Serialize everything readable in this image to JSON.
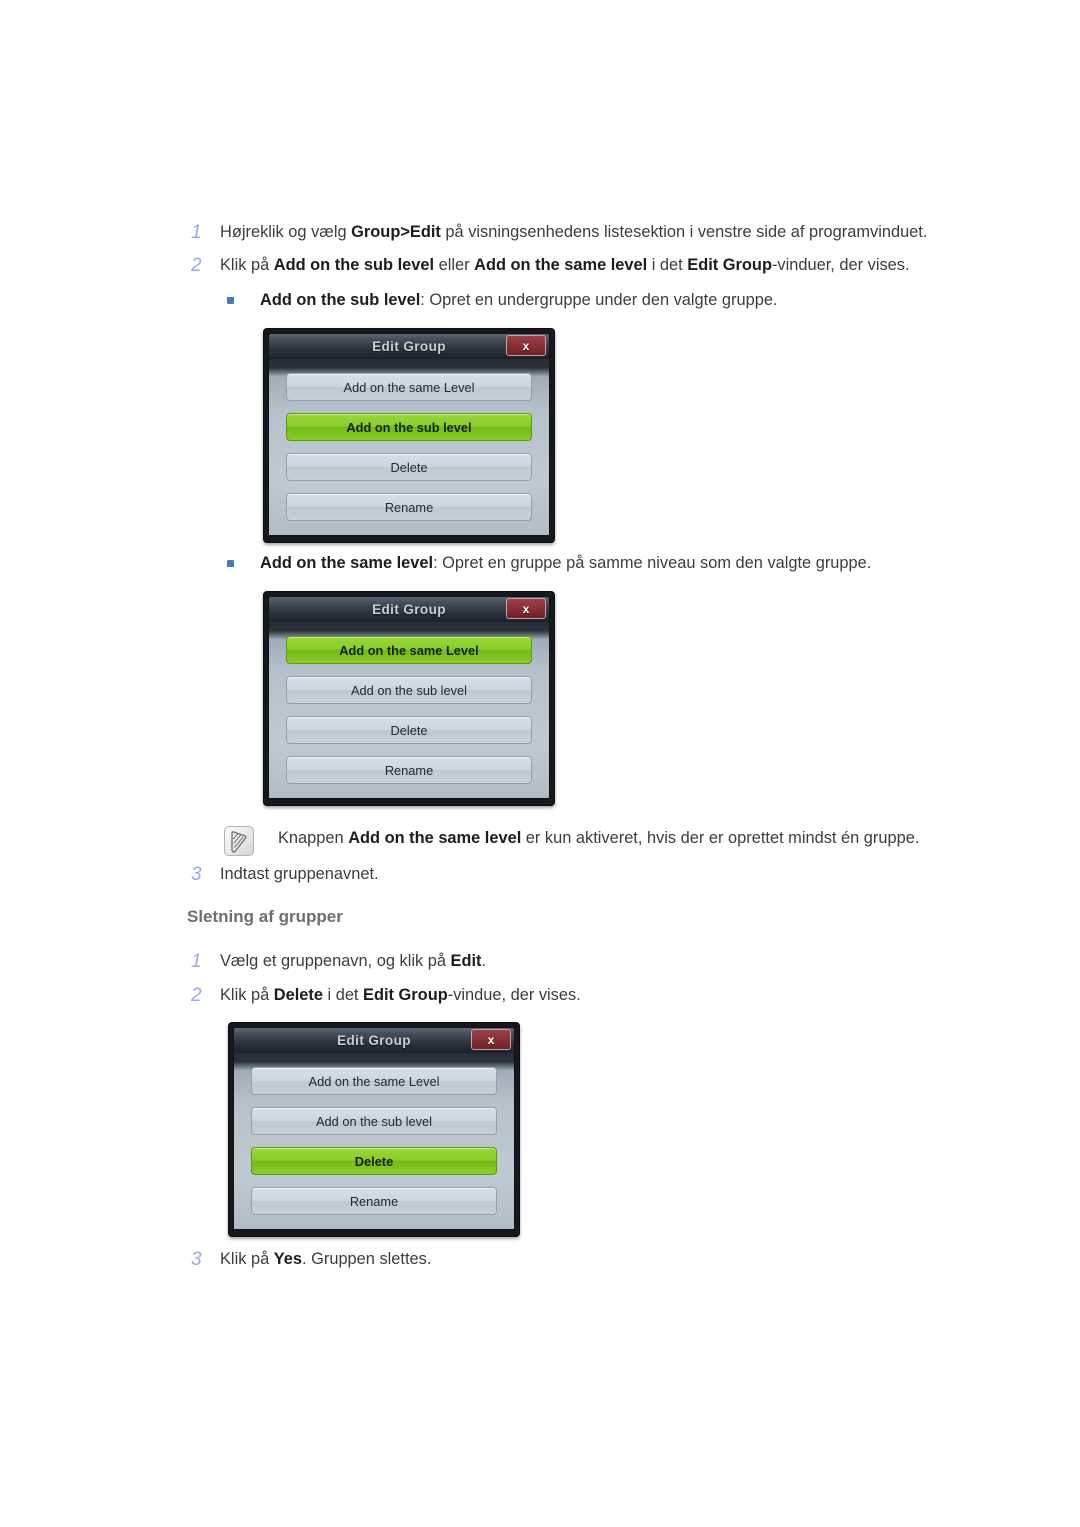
{
  "page": {
    "language": "da",
    "accent_number_color": "#9aa8e8",
    "bullet_color": "#4a7ab5",
    "heading_color": "#6e6e6e",
    "dialog_highlight_color": "#8ccd2c",
    "dialog_close_color": "#8a3138"
  },
  "steps": {
    "s1_num": "1",
    "s1_parts": [
      {
        "text": "Højreklik og vælg ",
        "bold": false
      },
      {
        "text": "Group>Edit",
        "bold": true
      },
      {
        "text": " på visningsenhedens listesektion i venstre side af programvinduet.",
        "bold": false
      }
    ],
    "s2_num": "2",
    "s2_parts": [
      {
        "text": "Klik på ",
        "bold": false
      },
      {
        "text": "Add on the sub level",
        "bold": true
      },
      {
        "text": " eller ",
        "bold": false
      },
      {
        "text": "Add on the same level",
        "bold": true
      },
      {
        "text": " i det ",
        "bold": false
      },
      {
        "text": "Edit Group",
        "bold": true
      },
      {
        "text": "-vinduer, der vises.",
        "bold": false
      }
    ],
    "s3_num": "3",
    "s3_parts": [
      {
        "text": "Indtast gruppenavnet.",
        "bold": false
      }
    ]
  },
  "bullets": {
    "b1_parts": [
      {
        "text": "Add on the sub level",
        "bold": true
      },
      {
        "text": ": Opret en undergruppe under den valgte gruppe.",
        "bold": false
      }
    ],
    "b2_parts": [
      {
        "text": "Add on the same level",
        "bold": true
      },
      {
        "text": ": Opret en gruppe på samme niveau som den valgte gruppe.",
        "bold": false
      }
    ]
  },
  "note": {
    "icon": "note-pencil-icon",
    "parts": [
      {
        "text": "Knappen ",
        "bold": false
      },
      {
        "text": "Add on the same level",
        "bold": true
      },
      {
        "text": " er kun aktiveret, hvis der er oprettet mindst én gruppe.",
        "bold": false
      }
    ]
  },
  "section": {
    "heading": "Sletning af grupper",
    "d1_num": "1",
    "d1_parts": [
      {
        "text": "Vælg et gruppenavn, og klik på ",
        "bold": false
      },
      {
        "text": "Edit",
        "bold": true
      },
      {
        "text": ".",
        "bold": false
      }
    ],
    "d2_num": "2",
    "d2_parts": [
      {
        "text": "Klik på ",
        "bold": false
      },
      {
        "text": "Delete",
        "bold": true
      },
      {
        "text": " i det ",
        "bold": false
      },
      {
        "text": "Edit Group",
        "bold": true
      },
      {
        "text": "-vindue, der vises.",
        "bold": false
      }
    ],
    "d3_num": "3",
    "d3_parts": [
      {
        "text": "Klik på ",
        "bold": false
      },
      {
        "text": "Yes",
        "bold": true
      },
      {
        "text": ". Gruppen slettes.",
        "bold": false
      }
    ]
  },
  "dialogs": [
    {
      "title": "Edit Group",
      "close_label": "x",
      "buttons": [
        {
          "label": "Add on the same Level",
          "active": false
        },
        {
          "label": "Add on the sub level",
          "active": true
        },
        {
          "label": "Delete",
          "active": false
        },
        {
          "label": "Rename",
          "active": false
        }
      ]
    },
    {
      "title": "Edit Group",
      "close_label": "x",
      "buttons": [
        {
          "label": "Add on the same Level",
          "active": true
        },
        {
          "label": "Add on the sub level",
          "active": false
        },
        {
          "label": "Delete",
          "active": false
        },
        {
          "label": "Rename",
          "active": false
        }
      ]
    },
    {
      "title": "Edit Group",
      "close_label": "x",
      "buttons": [
        {
          "label": "Add on the same Level",
          "active": false
        },
        {
          "label": "Add on the sub level",
          "active": false
        },
        {
          "label": "Delete",
          "active": true
        },
        {
          "label": "Rename",
          "active": false
        }
      ]
    }
  ]
}
